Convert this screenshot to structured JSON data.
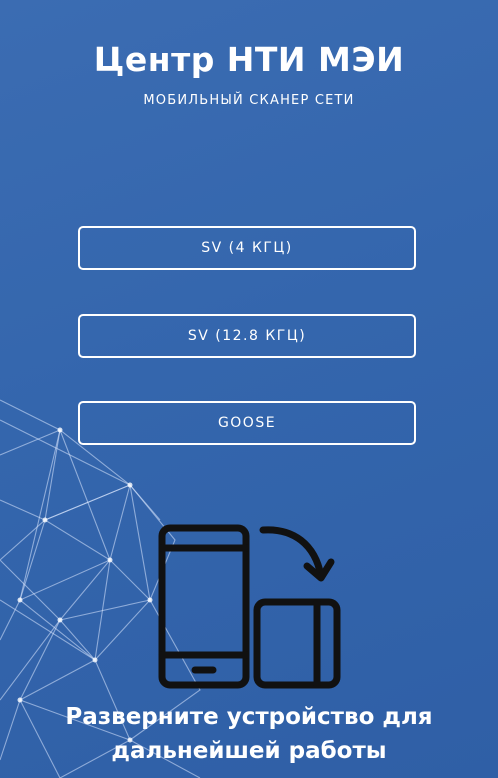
{
  "header": {
    "title": "Центр НТИ МЭИ",
    "subtitle": "МОБИЛЬНЫЙ СКАНЕР СЕТИ"
  },
  "modes": [
    {
      "label": "SV (4 КГЦ)"
    },
    {
      "label": "SV (12.8 КГЦ)"
    },
    {
      "label": "GOOSE"
    }
  ],
  "rotate_prompt": {
    "icon": "rotate-device-icon",
    "line1": "Разверните устройство для",
    "line2": "дальнейшей работы"
  },
  "colors": {
    "background": "#3466ad",
    "foreground": "#ffffff",
    "icon": "#111111"
  }
}
